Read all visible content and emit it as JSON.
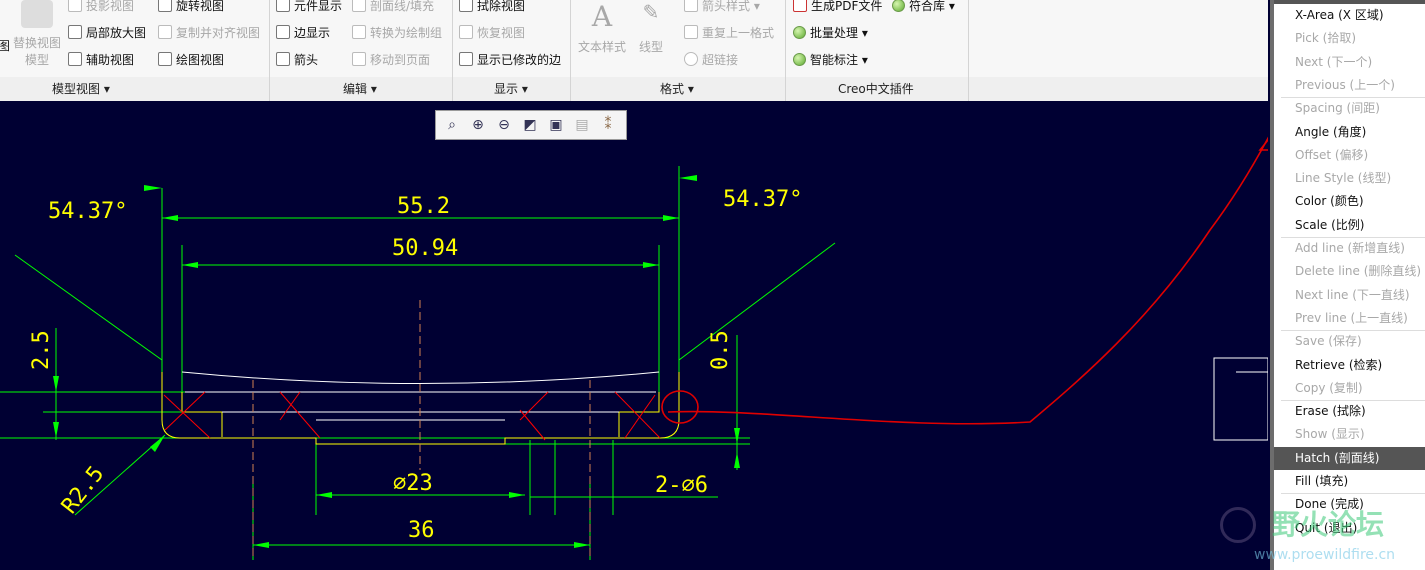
{
  "ribbon": {
    "groups": [
      {
        "label": "模型视图 ▾"
      },
      {
        "label": "编辑 ▾"
      },
      {
        "label": "显示 ▾"
      },
      {
        "label": "格式 ▾"
      },
      {
        "label": "Creo中文插件"
      }
    ],
    "model_view": {
      "cut_left": "图",
      "replace_view": "替换视图",
      "model": "模型",
      "projection": "投影视图",
      "detail": "局部放大图",
      "auxiliary": "辅助视图",
      "rotate": "旋转视图",
      "copy_align": "复制并对齐视图",
      "drawing_view": "绘图视图"
    },
    "edit": {
      "component_display": "元件显示",
      "edge_display": "边显示",
      "arrow": "箭头",
      "hatch_fill": "剖面线/填充",
      "convert_group": "转换为绘制组",
      "move_page": "移动到页面"
    },
    "display": {
      "erase_view": "拭除视图",
      "resume_view": "恢复视图",
      "show_modified_edges": "显示已修改的边"
    },
    "format": {
      "text_style": "文本样式",
      "line_style": "线型",
      "arrow_style": "箭头样式 ▾",
      "repeat_format": "重复上一格式",
      "hyperlink": "超链接"
    },
    "creo_plugin": {
      "pdf": "生成PDF文件",
      "symbol_lib": "符合库 ▾",
      "batch": "批量处理 ▾",
      "smart_dim": "智能标注 ▾"
    }
  },
  "view_toolbar": {
    "icons": [
      "zoom-fit-icon",
      "zoom-in-icon",
      "zoom-out-icon",
      "repaint-icon",
      "display-style-icon",
      "saved-views-icon",
      "datum-display-icon"
    ]
  },
  "drawing": {
    "dims": {
      "angle_left": "54.37°",
      "angle_right": "54.37°",
      "d1": "55.2",
      "d2": "50.94",
      "h1": "2.5",
      "h2": "0.5",
      "radius": "R2.5",
      "dia1": "∅23",
      "dia2": "2-∅6",
      "w": "36"
    },
    "colors": {
      "background": "#000033",
      "dimension": "#00ff00",
      "text": "#ffff00",
      "hatch": "#ff0000",
      "edge": "#ffffff",
      "annotation": "#e00000"
    }
  },
  "menu": {
    "items": [
      {
        "label": "X-Area (X 区域)",
        "enabled": true
      },
      {
        "label": "Pick (拾取)",
        "enabled": false
      },
      {
        "label": "Next (下一个)",
        "enabled": false
      },
      {
        "label": "Previous (上一个)",
        "enabled": false
      },
      {
        "label": "Spacing (间距)",
        "enabled": false
      },
      {
        "label": "Angle (角度)",
        "enabled": true
      },
      {
        "label": "Offset (偏移)",
        "enabled": false
      },
      {
        "label": "Line Style (线型)",
        "enabled": false
      },
      {
        "label": "Color (颜色)",
        "enabled": true
      },
      {
        "label": "Scale (比例)",
        "enabled": true
      },
      {
        "label": "Add line (新增直线)",
        "enabled": false
      },
      {
        "label": "Delete line (删除直线)",
        "enabled": false
      },
      {
        "label": "Next line (下一直线)",
        "enabled": false
      },
      {
        "label": "Prev line (上一直线)",
        "enabled": false
      },
      {
        "label": "Save (保存)",
        "enabled": false
      },
      {
        "label": "Retrieve (检索)",
        "enabled": true
      },
      {
        "label": "Copy (复制)",
        "enabled": false
      },
      {
        "label": "Erase (拭除)",
        "enabled": true
      },
      {
        "label": "Show (显示)",
        "enabled": false
      },
      {
        "label": "Hatch (剖面线)",
        "enabled": true,
        "selected": true
      },
      {
        "label": "Fill (填充)",
        "enabled": true
      },
      {
        "label": "Done (完成)",
        "enabled": true
      },
      {
        "label": "Quit (退出)",
        "enabled": true
      }
    ]
  },
  "watermark": {
    "text": "野火论坛",
    "url": "www.proewildfire.cn"
  }
}
